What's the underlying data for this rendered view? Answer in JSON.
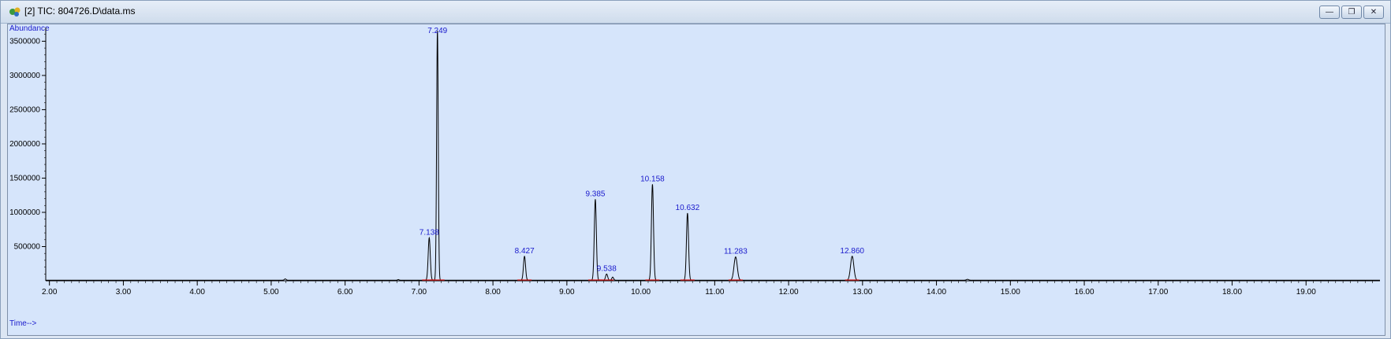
{
  "window": {
    "title": "[2] TIC: 804726.D\\data.ms",
    "buttons": [
      "minimize",
      "restore",
      "close"
    ],
    "icons": [
      "chromatogram-app-icon",
      "minimize-icon",
      "restore-icon",
      "close-icon"
    ]
  },
  "colors": {
    "background": "#d6e5fb",
    "trace": "#000000",
    "labels": "#1a1acc",
    "baseline_marks": "#d01818"
  },
  "chart_data": {
    "type": "line",
    "title": "",
    "ylabel": "Abundance",
    "xlabel": "Time-->",
    "xlim": [
      1.95,
      20.0
    ],
    "ylim": [
      0,
      3700000
    ],
    "x_ticks": [
      "2.00",
      "3.00",
      "4.00",
      "5.00",
      "6.00",
      "7.00",
      "8.00",
      "9.00",
      "10.00",
      "11.00",
      "12.00",
      "13.00",
      "14.00",
      "15.00",
      "16.00",
      "17.00",
      "18.00",
      "19.00"
    ],
    "y_ticks": [
      "500000",
      "1000000",
      "1500000",
      "2000000",
      "2500000",
      "3000000",
      "3500000"
    ],
    "grid": false,
    "peaks": [
      {
        "label": "7.138",
        "time": 7.138,
        "height": 620000
      },
      {
        "label": "7.249",
        "time": 7.249,
        "height": 3650000
      },
      {
        "label": "8.427",
        "time": 8.427,
        "height": 350000
      },
      {
        "label": "9.385",
        "time": 9.385,
        "height": 1180000
      },
      {
        "label": "9.538",
        "time": 9.538,
        "height": 90000
      },
      {
        "label": "10.158",
        "time": 10.158,
        "height": 1400000
      },
      {
        "label": "10.632",
        "time": 10.632,
        "height": 980000
      },
      {
        "label": "11.283",
        "time": 11.283,
        "height": 340000
      },
      {
        "label": "12.860",
        "time": 12.86,
        "height": 350000
      }
    ]
  }
}
